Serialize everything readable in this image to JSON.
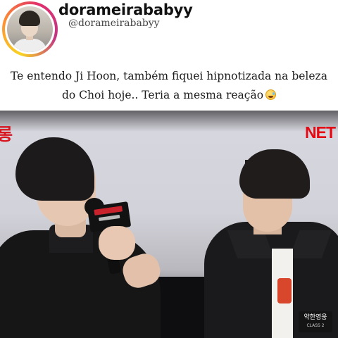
{
  "post": {
    "username": "dorameirababyy",
    "handle": "@dorameirababyy",
    "caption_line1": "Te entendo Ji Hoon, também fiquei hipnotizada na beleza",
    "caption_line2": "do Choi hoje.. Teria a mesma reação",
    "caption_emoji": "grinning-sweat-emoji"
  },
  "video": {
    "corner_mark": "롱",
    "brand": "NETFLIX",
    "brand_visible": "NET",
    "watermark_title": "약한영웅",
    "watermark_subtitle": "CLASS 2"
  },
  "colors": {
    "brand_red": "#e50914",
    "caption_text": "#1c1c1c"
  }
}
